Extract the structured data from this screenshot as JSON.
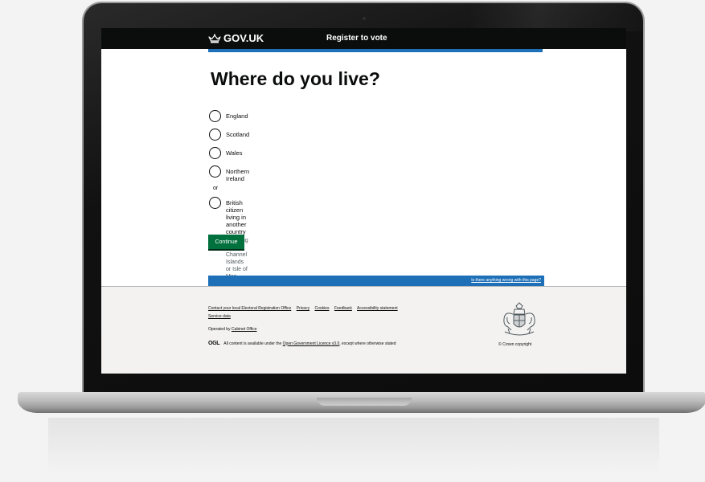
{
  "header": {
    "logo_text": "GOV.UK",
    "service_name": "Register to vote"
  },
  "main": {
    "title": "Where do you live?",
    "options": [
      {
        "label": "England"
      },
      {
        "label": "Scotland"
      },
      {
        "label": "Wales"
      },
      {
        "label": "Northern Ireland"
      },
      {
        "label": "British citizen living in another country",
        "hint": "including the Channel Islands or Isle of Man"
      }
    ],
    "divider_text": "or",
    "continue_label": "Continue"
  },
  "feedback": {
    "link_text": "Is there anything wrong with this page?"
  },
  "footer": {
    "links": [
      "Contact your local Electoral Registration Office",
      "Privacy",
      "Cookies",
      "Feedback",
      "Accessibility statement",
      "Service data"
    ],
    "operated_prefix": "Operated by",
    "operated_link": "Cabinet Office",
    "ogl_label": "OGL",
    "licence_prefix": "All content is available under the",
    "licence_link": "Open Government Licence v3.0",
    "licence_suffix": ", except where otherwise stated",
    "copyright": "© Crown copyright"
  },
  "colors": {
    "header_bg": "#0b0c0c",
    "accent_blue": "#1d70b8",
    "button_green": "#00703c",
    "footer_bg": "#f3f2f1"
  }
}
